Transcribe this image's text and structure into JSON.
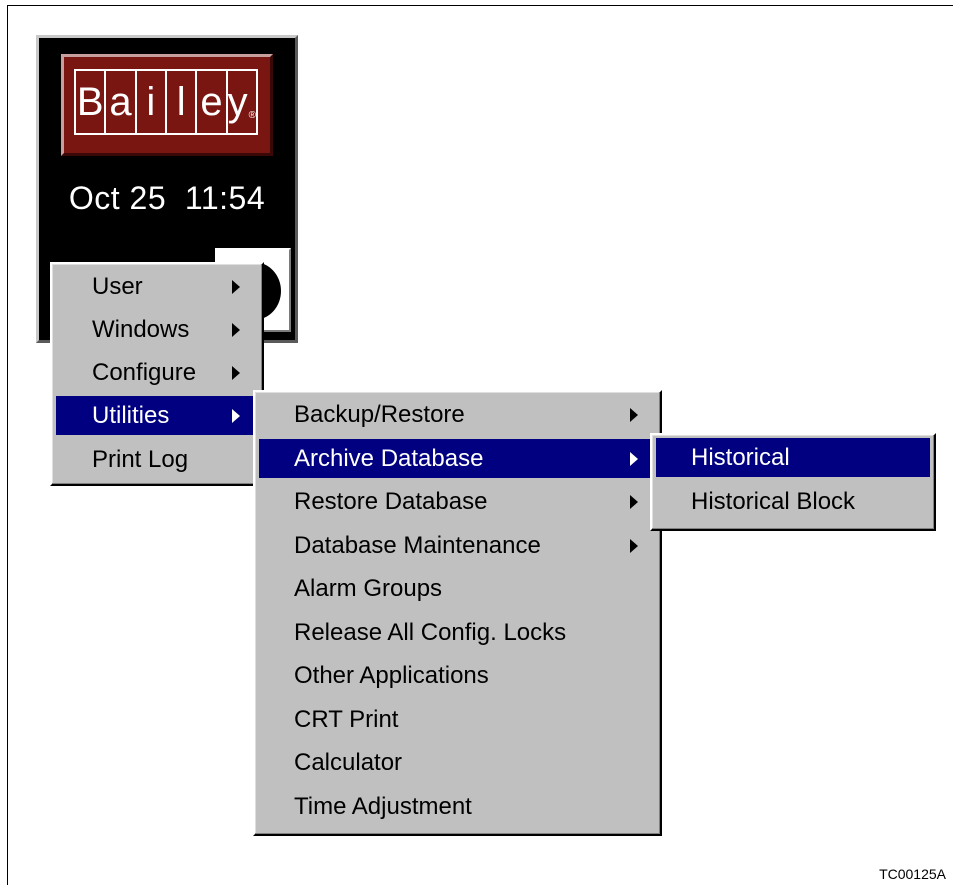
{
  "panel": {
    "logo_letters": [
      "B",
      "a",
      "i",
      "l",
      "e",
      "y"
    ],
    "logo_mark": "®",
    "clock": "Oct 25  11:54"
  },
  "main_menu": {
    "items": [
      {
        "label": "User",
        "submenu": true,
        "selected": false
      },
      {
        "label": "Windows",
        "submenu": true,
        "selected": false
      },
      {
        "label": "Configure",
        "submenu": true,
        "selected": false
      },
      {
        "label": "Utilities",
        "submenu": true,
        "selected": true
      },
      {
        "label": "Print Log",
        "submenu": false,
        "selected": false
      }
    ]
  },
  "utilities_menu": {
    "items": [
      {
        "label": "Backup/Restore",
        "submenu": true,
        "selected": false
      },
      {
        "label": "Archive Database",
        "submenu": true,
        "selected": true
      },
      {
        "label": "Restore Database",
        "submenu": true,
        "selected": false
      },
      {
        "label": "Database Maintenance",
        "submenu": true,
        "selected": false
      },
      {
        "label": "Alarm Groups",
        "submenu": false,
        "selected": false
      },
      {
        "label": "Release All Config. Locks",
        "submenu": false,
        "selected": false
      },
      {
        "label": "Other Applications",
        "submenu": false,
        "selected": false
      },
      {
        "label": "CRT Print",
        "submenu": false,
        "selected": false
      },
      {
        "label": "Calculator",
        "submenu": false,
        "selected": false
      },
      {
        "label": "Time Adjustment",
        "submenu": false,
        "selected": false
      }
    ]
  },
  "archive_menu": {
    "items": [
      {
        "label": "Historical",
        "submenu": false,
        "selected": true
      },
      {
        "label": "Historical Block",
        "submenu": false,
        "selected": false
      }
    ]
  },
  "figure_id": "TC00125A",
  "colors": {
    "selection": "#000080",
    "menu_bg": "#c0c0c0",
    "logo_red": "#7a1612",
    "panel_bg": "#000000"
  }
}
